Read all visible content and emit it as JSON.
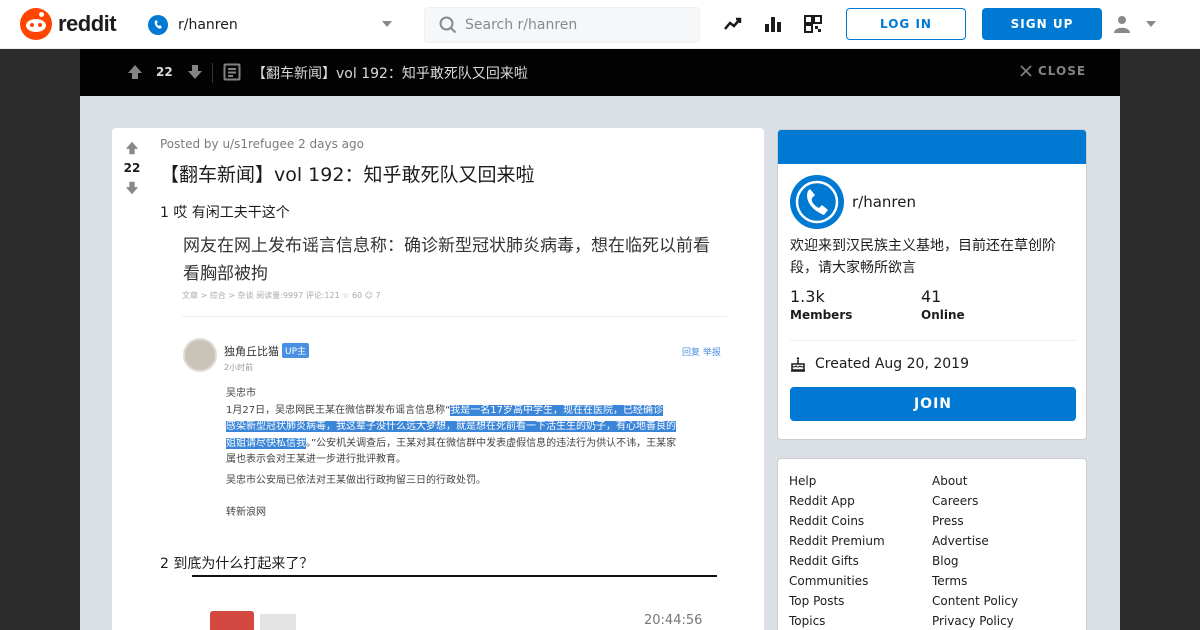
{
  "header": {
    "logo_text": "reddit",
    "community": "r/hanren",
    "search_placeholder": "Search r/hanren",
    "login_label": "LOG IN",
    "signup_label": "SIGN UP"
  },
  "postbar": {
    "score": "22",
    "title": "【翻车新闻】vol 192：知乎敢死队又回来啦",
    "close_label": "CLOSE"
  },
  "post": {
    "score": "22",
    "meta": "Posted by u/s1refugee 2 days ago",
    "title": "【翻车新闻】vol 192：知乎敢死队又回来啦",
    "para1": "1 哎 有闲工夫干这个",
    "para2": "2 到底为什么打起来了？",
    "image1": {
      "headline": "网友在网上发布谣言信息称：确诊新型冠状肺炎病毒，想在临死以前看看胸部被拘",
      "subline": "文章 > 综合 > 杂谈    阅读量:9997    评论:121          ☆ 60     ☺ 7",
      "username": "独角丘比猫",
      "badge": "UP主",
      "time": "2小时前",
      "reply": "回复  举报",
      "line1": "吴忠市",
      "line2a": "1月27日，吴忠网民王某在微信群发布谣言信息称“",
      "line2b": "我是一名17岁高中学生，现在在医院，已经确诊",
      "line3": "感染新型冠状肺炎病毒，我这辈子没什么远大梦想，就是想在死前看一下活生生的奶子，有心地善良的",
      "line4a": "姐姐请尽快私信我",
      "line4b": "。”公安机关调查后，王某对其在微信群中发表虚假信息的违法行为供认不讳，王某家",
      "line5": "属也表示会对王某进一步进行批评教育。",
      "line6": "吴忠市公安局已依法对王某做出行政拘留三日的行政处罚。",
      "source": "转新浪网"
    },
    "image2_time": "20:44:56"
  },
  "sidebar": {
    "name": "r/hanren",
    "description": "欢迎来到汉民族主义基地，目前还在草创阶段，请大家畅所欲言",
    "members_count": "1.3k",
    "members_label": "Members",
    "online_count": "41",
    "online_label": "Online",
    "created": "Created Aug 20, 2019",
    "join_label": "JOIN"
  },
  "footer_links": {
    "col1": [
      "Help",
      "Reddit App",
      "Reddit Coins",
      "Reddit Premium",
      "Reddit Gifts",
      "Communities",
      "Top Posts",
      "Topics"
    ],
    "col2": [
      "About",
      "Careers",
      "Press",
      "Advertise",
      "Blog",
      "Terms",
      "Content Policy",
      "Privacy Policy"
    ]
  },
  "colors": {
    "brand": "#ff4500",
    "accent": "#0079d3",
    "highlight": "#3b85d8"
  }
}
